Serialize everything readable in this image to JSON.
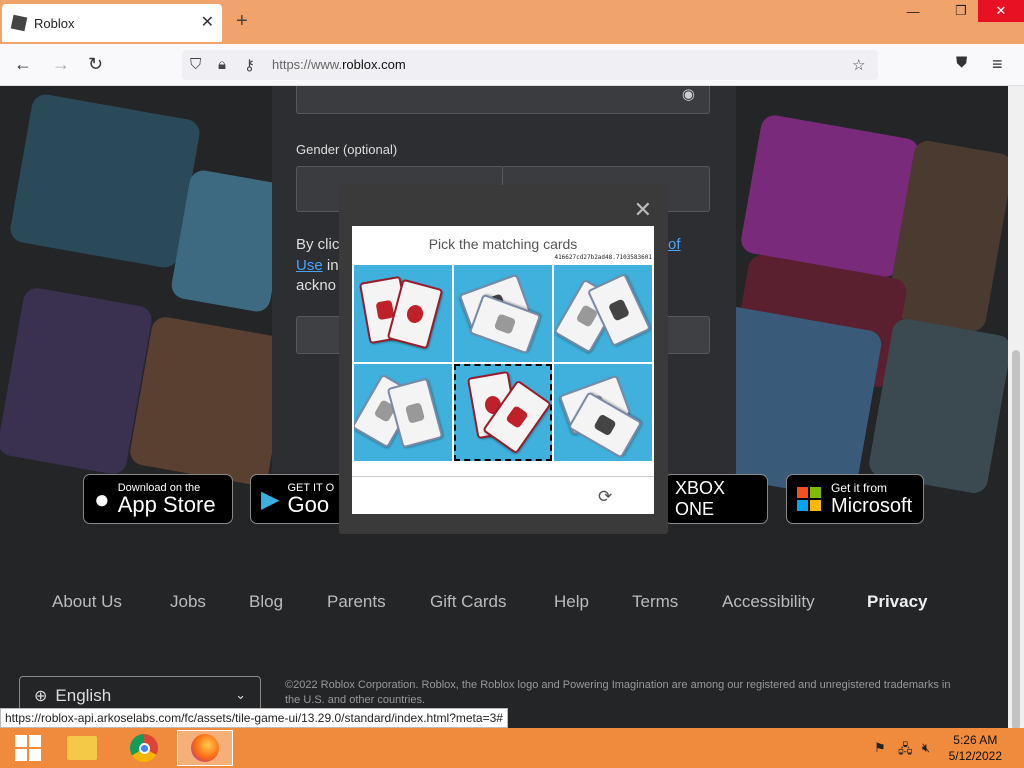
{
  "browser": {
    "tab_title": "Roblox",
    "tab_close": "✕",
    "new_tab": "+",
    "url_scheme": "https://www.",
    "url_host": "roblox.com",
    "window_controls": {
      "minimize": "—",
      "restore": "❐",
      "close": "✕"
    }
  },
  "signup": {
    "gender_label": "Gender (optional)",
    "terms_prefix": "By clic",
    "terms_link_end": "of",
    "terms_use": "Use",
    "terms_in": " in",
    "terms_ackno": "ackno"
  },
  "captcha": {
    "title": "Pick the matching cards",
    "session_id": "416627cd27b2ad48.7103583601",
    "close": "✕",
    "refresh": "⟳",
    "selected_cell": 4
  },
  "badges": {
    "app_store_small": "Download on the",
    "app_store_big": "App Store",
    "google_small": "GET IT O",
    "google_big": "Goo",
    "xbox": "XBOX ONE",
    "microsoft_small": "Get it from",
    "microsoft_big": "Microsoft"
  },
  "footer": {
    "links": [
      "About Us",
      "Jobs",
      "Blog",
      "Parents",
      "Gift Cards",
      "Help",
      "Terms",
      "Accessibility",
      "Privacy"
    ],
    "language": "English",
    "copyright": "©2022 Roblox Corporation. Roblox, the Roblox logo and Powering Imagination are among our registered and unregistered trademarks in the U.S. and other countries."
  },
  "status_bar_url": "https://roblox-api.arkoselabs.com/fc/assets/tile-game-ui/13.29.0/standard/index.html?meta=3#",
  "taskbar": {
    "time": "5:26 AM",
    "date": "5/12/2022"
  },
  "colors": {
    "tabbar": "#f0a46c",
    "taskbar": "#f08a3c",
    "captcha_bg": "#3fb1dc",
    "link": "#4aa3ff"
  }
}
